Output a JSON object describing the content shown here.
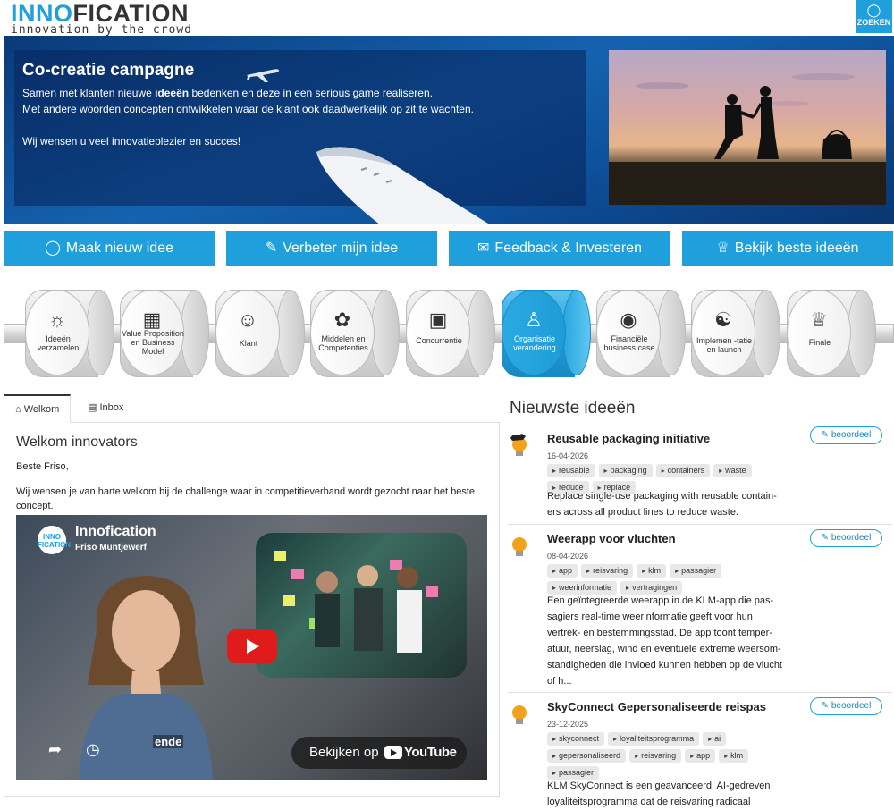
{
  "header": {
    "logo_part1": "INNO",
    "logo_part2": "FICATION",
    "logo_tagline": "innovation by the crowd",
    "search_label": "ZOEKEN",
    "search_icon": "lightbulb-icon"
  },
  "banner": {
    "title": "Co-creatie campagne",
    "line1_pre": "Samen met klanten nieuwe ",
    "line1_bold": "ideeën",
    "line1_post": " bedenken en deze in een serious game realiseren.",
    "line2": "Met andere woorden concepten ontwikkelen waar de klant ook daadwerkelijk op zit te wachten.",
    "line3": "Wij wensen u veel innovatieplezier en succes!"
  },
  "actions": [
    {
      "label": "Maak nieuw idee",
      "icon": "lightbulb-icon"
    },
    {
      "label": "Verbeter mijn idee",
      "icon": "edit-icon"
    },
    {
      "label": "Feedback & Investeren",
      "icon": "comments-icon"
    },
    {
      "label": "Bekijk beste ideeën",
      "icon": "trophy-icon"
    }
  ],
  "stages": [
    {
      "label": "Ideeën verzamelen",
      "icon": "lightbulb-icon"
    },
    {
      "label": "Value Proposition en Business Model",
      "icon": "gift-icon"
    },
    {
      "label": "Klant",
      "icon": "customers-icon"
    },
    {
      "label": "Middelen en Competenties",
      "icon": "brain-icon"
    },
    {
      "label": "Concurrentie",
      "icon": "gamepad-icon"
    },
    {
      "label": "Organisatie verandering",
      "icon": "organization-icon"
    },
    {
      "label": "Financiële business case",
      "icon": "coins-icon"
    },
    {
      "label": "Implemen -tatie en launch",
      "icon": "team-icon"
    },
    {
      "label": "Finale",
      "icon": "trophy-icon"
    }
  ],
  "tabs": [
    {
      "label": "Welkom",
      "icon": "home-icon"
    },
    {
      "label": "Inbox",
      "icon": "inbox-icon"
    }
  ],
  "welcome": {
    "title": "Welkom innovators",
    "greeting": "Beste Friso,",
    "text": "Wij wensen je van harte welkom bij de challenge waar in competitieverband wordt gezocht naar het beste concept."
  },
  "video": {
    "channel_logo": "INNO FICATION",
    "title": "Innofication",
    "author": "Friso Muntjewerf",
    "caption": "ende",
    "watch_label": "Bekijken op",
    "platform": "YouTube"
  },
  "newest": {
    "title": "Nieuwste ideeën",
    "rate_label": "beoordeel",
    "items": [
      {
        "title": "Reusable packaging initiative",
        "date": "16-04-2026",
        "tags": [
          "reusable",
          "packaging",
          "containers",
          "waste",
          "reduce",
          "replace"
        ],
        "desc": "Replace single-use packaging with reusable contain- ers across all product lines to reduce waste."
      },
      {
        "title": "Weerapp voor vluchten",
        "date": "08-04-2026",
        "tags": [
          "app",
          "reisvaring",
          "klm",
          "passagier",
          "weerinformatie",
          "vertragingen"
        ],
        "desc": "Een geïntegreerde weerapp in de KLM-app die pas- sagiers real-time weerinformatie geeft voor hun vertrek- en bestemmingsstad. De app toont temper- atuur, neerslag, wind en eventuele extreme weersom- standigheden die invloed kunnen hebben op de vlucht of h..."
      },
      {
        "title": "SkyConnect Gepersonaliseerde reispas",
        "date": "23-12-2025",
        "tags": [
          "skyconnect",
          "loyaliteitsprogramma",
          "ai",
          "gepersonaliseerd",
          "reisvaring",
          "app",
          "klm",
          "passagier"
        ],
        "desc": "KLM SkyConnect is een geavanceerd, AI-gedreven loyaliteitsprogramma dat de reisvaring radicaal"
      }
    ]
  },
  "colors": {
    "accent": "#1fa0dc",
    "dark": "#333333"
  }
}
